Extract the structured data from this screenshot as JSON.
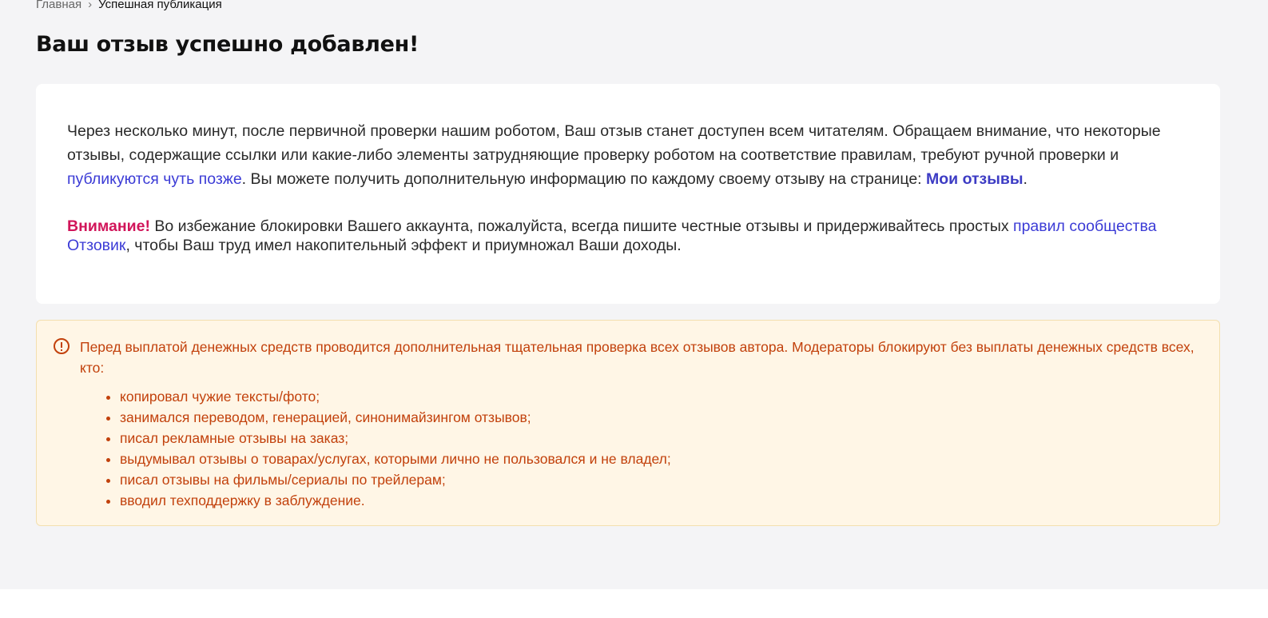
{
  "breadcrumb": {
    "home": "Главная",
    "separator": "›",
    "current": "Успешная публикация"
  },
  "page_title": "Ваш отзыв успешно добавлен!",
  "card": {
    "p1_text1": "Через несколько минут, после первичной проверки нашим роботом, Ваш отзыв станет доступен всем читателям. Обращаем внимание, что некоторые отзывы, содержащие ссылки или какие-либо элементы затрудняющие проверку роботом на соответствие правилам, требуют ручной проверки и ",
    "p1_link1": "публикуются чуть позже",
    "p1_text2": ". Вы можете получить дополнительную информацию по каждому своему отзыву на странице: ",
    "p1_link2": "Мои отзывы",
    "p1_text3": ".",
    "p2_warning": "Внимание!",
    "p2_text1": " Во избежание блокировки Вашего аккаунта, пожалуйста, всегда пишите честные отзывы и придерживайтесь простых ",
    "p2_link": "правил сообщества Отзовик",
    "p2_text2": ", чтобы Ваш труд имел накопительный эффект и приумножал Ваши доходы."
  },
  "notice": {
    "icon": "exclamation-circle-icon",
    "lead": "Перед выплатой денежных средств проводится дополнительная тщательная проверка всех отзывов автора. Модераторы блокируют без выплаты денежных средств всех, кто:",
    "items": [
      "копировал чужие тексты/фото;",
      "занимался переводом, генерацией, синонимайзингом отзывов;",
      "писал рекламные отзывы на заказ;",
      "выдумывал отзывы о товарах/услугах, которыми лично не пользовался и не владел;",
      "писал отзывы на фильмы/сериалы по трейлерам;",
      "вводил техподдержку в заблуждение."
    ]
  },
  "colors": {
    "link": "#3b3bd6",
    "warning": "#d1155a",
    "notice_text": "#c2410c",
    "notice_bg": "#fff6e6",
    "page_bg": "#f4f4f6"
  }
}
